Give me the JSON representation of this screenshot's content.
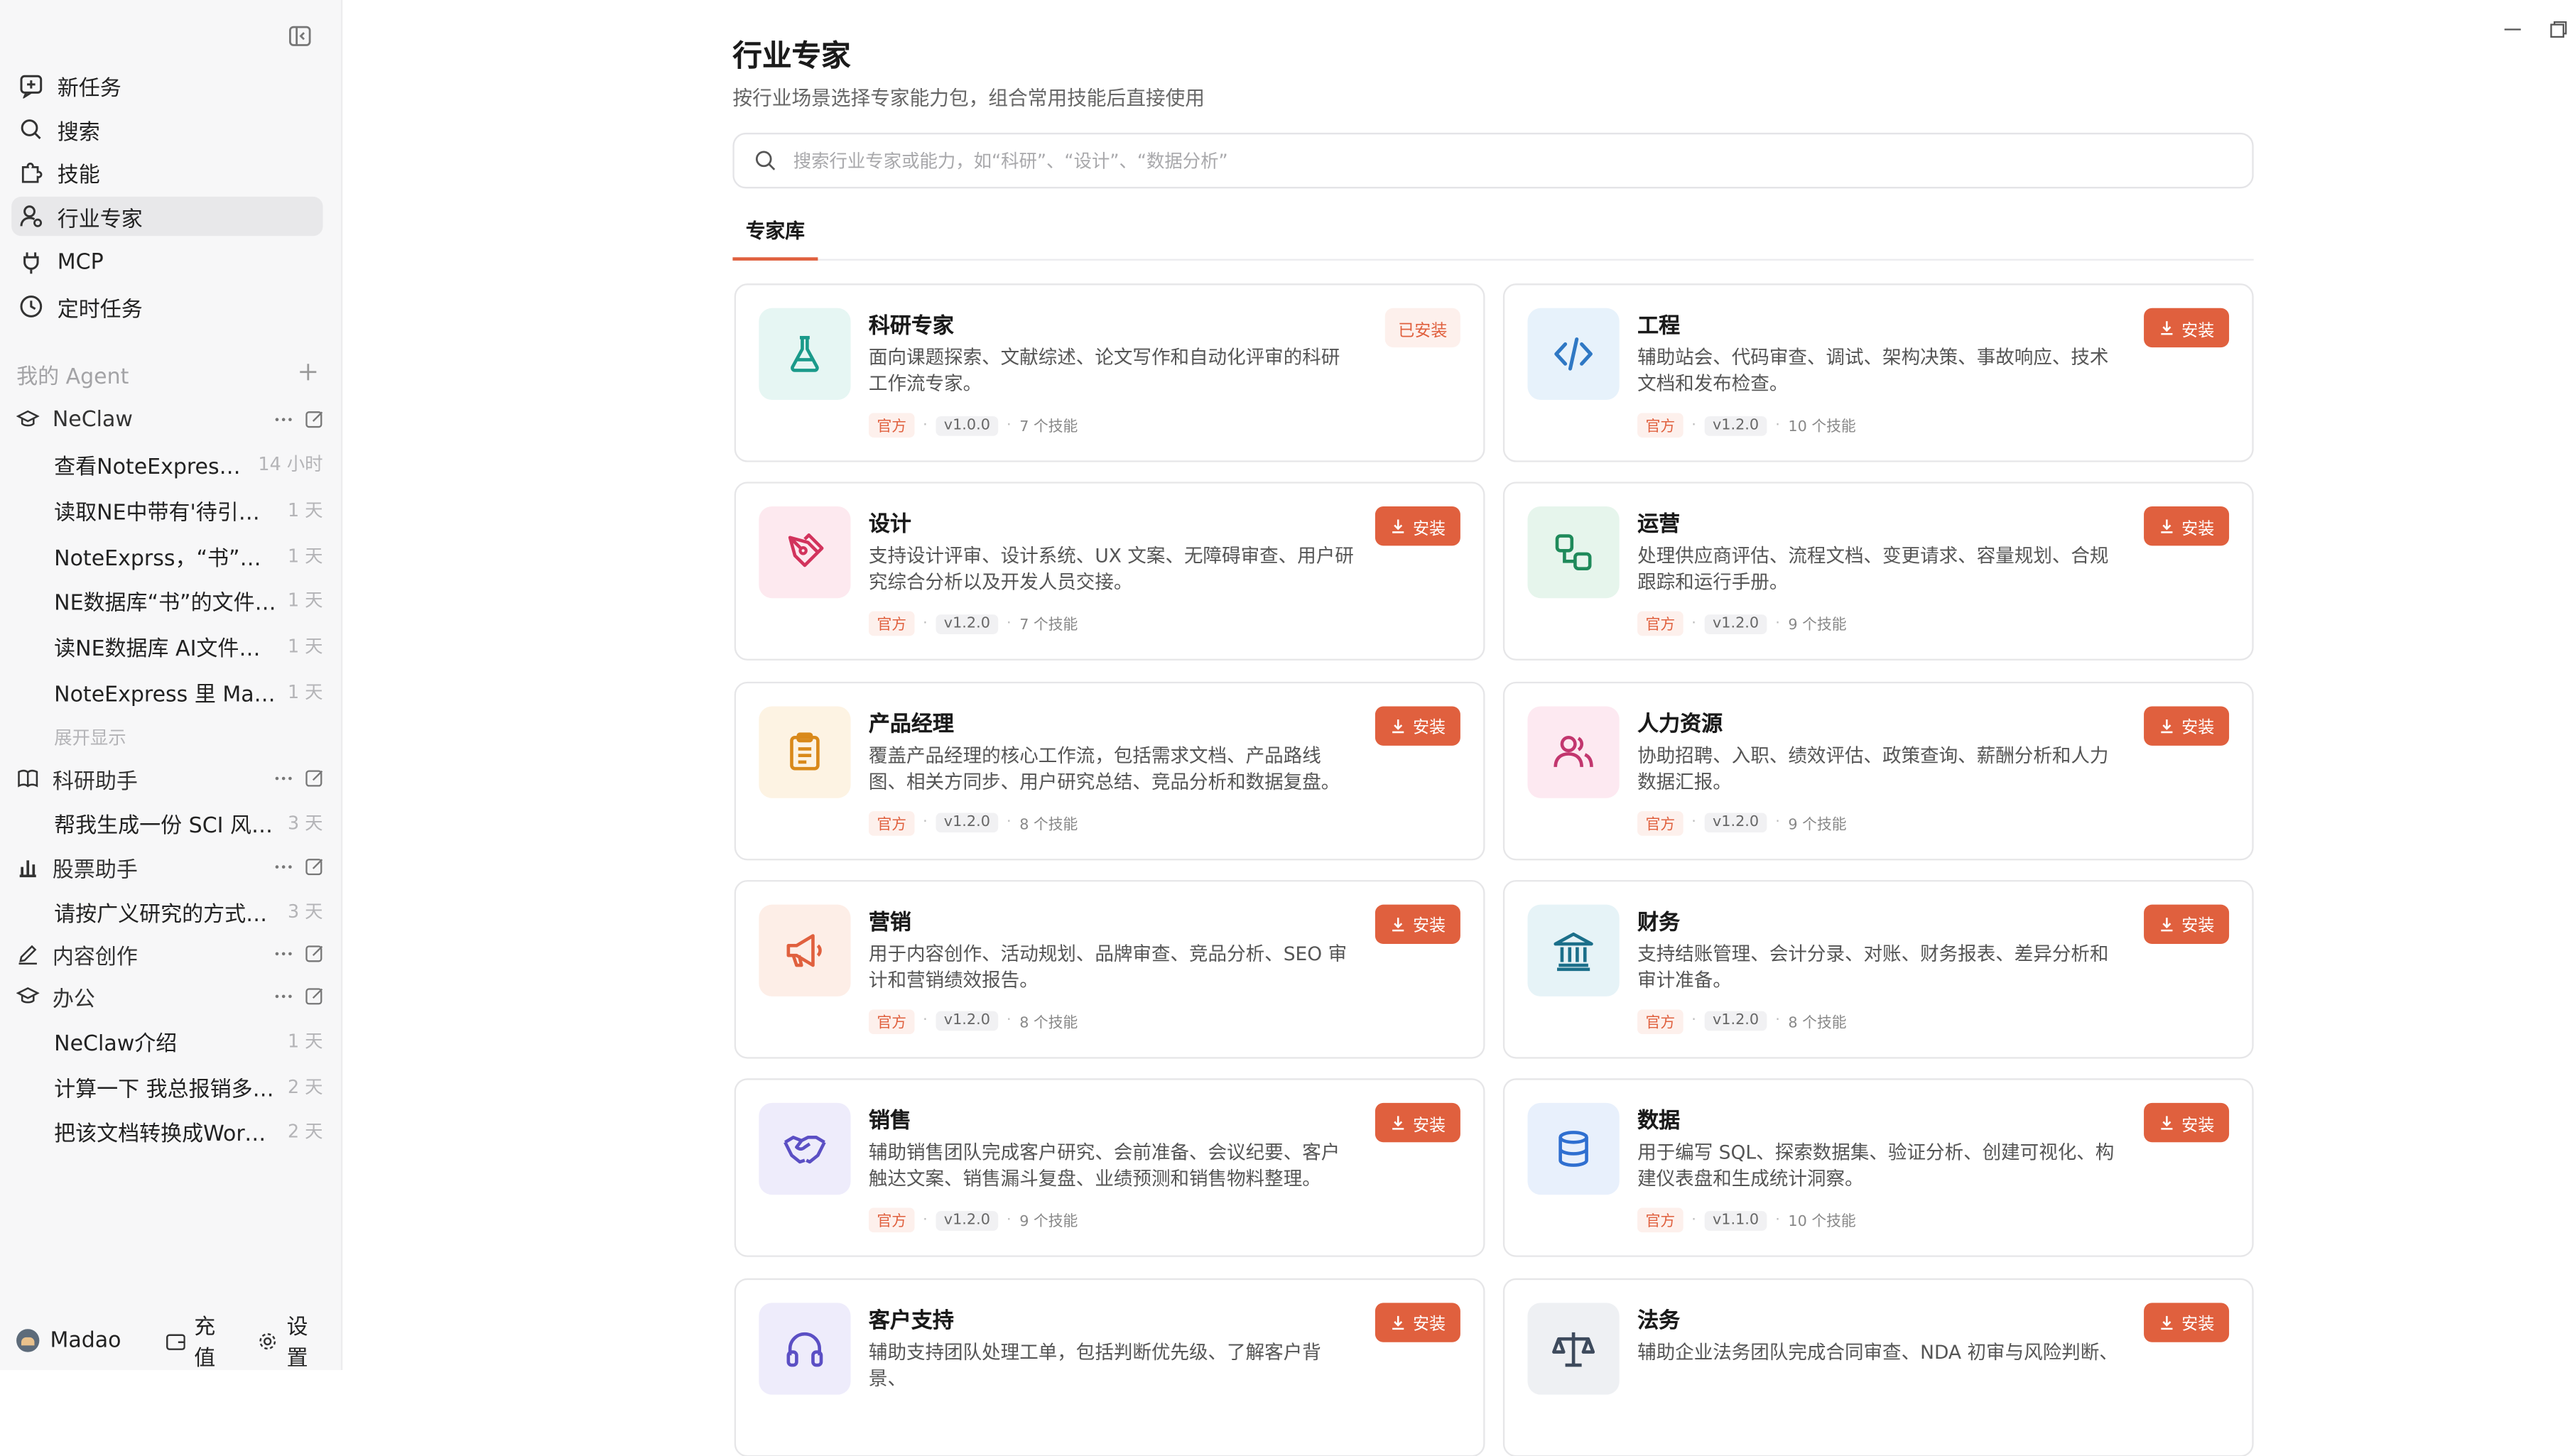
{
  "sidebar": {
    "nav": [
      {
        "label": "新任务",
        "icon": "new-task-icon"
      },
      {
        "label": "搜索",
        "icon": "search-icon"
      },
      {
        "label": "技能",
        "icon": "puzzle-icon"
      },
      {
        "label": "行业专家",
        "icon": "user-expert-icon",
        "active": true
      },
      {
        "label": "MCP",
        "icon": "plug-icon"
      },
      {
        "label": "定时任务",
        "icon": "clock-icon"
      }
    ],
    "section_title": "我的 Agent",
    "agents": [
      {
        "name": "NeClaw",
        "icon": "graduation-cap-icon"
      },
      {
        "name": "科研助手",
        "icon": "book-icon"
      },
      {
        "name": "股票助手",
        "icon": "bar-chart-icon"
      },
      {
        "name": "内容创作",
        "icon": "pen-icon"
      },
      {
        "name": "办公",
        "icon": "graduation-cap-icon"
      }
    ],
    "neclaw_convs": [
      {
        "title": "查看NoteExpress数...",
        "time": "14 小时"
      },
      {
        "title": "读取NE中带有'待引用'...",
        "time": "1 天"
      },
      {
        "title": "NoteExprss，“书”文件...",
        "time": "1 天"
      },
      {
        "title": "NE数据库“书”的文件夹...",
        "time": "1 天"
      },
      {
        "title": "读NE数据库 AI文件夹...",
        "time": "1 天"
      },
      {
        "title": "NoteExpress 里 Math...",
        "time": "1 天"
      }
    ],
    "expand_more": "展开显示",
    "research_convs": [
      {
        "title": "帮我生成一份 SCI 风格...",
        "time": "3 天"
      }
    ],
    "stock_convs": [
      {
        "title": "请按广义研究的方式，...",
        "time": "3 天"
      }
    ],
    "office_convs": [
      {
        "title": "NeClaw介绍",
        "time": "1 天"
      },
      {
        "title": "计算一下 我总报销多少...",
        "time": "2 天"
      },
      {
        "title": "把该文档转换成Word ...",
        "time": "2 天"
      }
    ],
    "footer": {
      "user": "Madao",
      "recharge": "充值",
      "settings": "设置"
    }
  },
  "main": {
    "title": "行业专家",
    "subtitle": "按行业场景选择专家能力包，组合常用技能后直接使用",
    "search_placeholder": "搜索行业专家或能力，如“科研”、“设计”、“数据分析”",
    "tab": "专家库",
    "official_label": "官方",
    "install_label": "安装",
    "installed_label": "已安装",
    "cards": [
      {
        "title": "科研专家",
        "desc": "面向课题探索、文献综述、论文写作和自动化评审的科研工作流专家。",
        "version": "v1.0.0",
        "skills": "7 个技能",
        "installed": true,
        "icon": "flask-icon",
        "color": "#1a9a8a",
        "bg": "#e6f6f3"
      },
      {
        "title": "工程",
        "desc": "辅助站会、代码审查、调试、架构决策、事故响应、技术文档和发布检查。",
        "version": "v1.2.0",
        "skills": "10 个技能",
        "installed": false,
        "icon": "code-icon",
        "color": "#2f78c4",
        "bg": "#e7f2fb"
      },
      {
        "title": "设计",
        "desc": "支持设计评审、设计系统、UX 文案、无障碍审查、用户研究综合分析以及开发人员交接。",
        "version": "v1.2.0",
        "skills": "7 个技能",
        "installed": false,
        "icon": "pen-nib-icon",
        "color": "#d2335c",
        "bg": "#fde9ef"
      },
      {
        "title": "运营",
        "desc": "处理供应商评估、流程文档、变更请求、容量规划、合规跟踪和运行手册。",
        "version": "v1.2.0",
        "skills": "9 个技能",
        "installed": false,
        "icon": "workflow-icon",
        "color": "#1f8a5a",
        "bg": "#e6f5ec"
      },
      {
        "title": "产品经理",
        "desc": "覆盖产品经理的核心工作流，包括需求文档、产品路线图、相关方同步、用户研究总结、竞品分析和数据复盘。",
        "version": "v1.2.0",
        "skills": "8 个技能",
        "installed": false,
        "icon": "clipboard-icon",
        "color": "#d9891a",
        "bg": "#fdf3e3"
      },
      {
        "title": "人力资源",
        "desc": "协助招聘、入职、绩效评估、政策查询、薪酬分析和人力数据汇报。",
        "version": "v1.2.0",
        "skills": "9 个技能",
        "installed": false,
        "icon": "users-icon",
        "color": "#c2366e",
        "bg": "#fde9f1"
      },
      {
        "title": "营销",
        "desc": "用于内容创作、活动规划、品牌审查、竞品分析、SEO 审计和营销绩效报告。",
        "version": "v1.2.0",
        "skills": "8 个技能",
        "installed": false,
        "icon": "megaphone-icon",
        "color": "#e0603e",
        "bg": "#fdeee7"
      },
      {
        "title": "财务",
        "desc": "支持结账管理、会计分录、对账、财务报表、差异分析和审计准备。",
        "version": "v1.2.0",
        "skills": "8 个技能",
        "installed": false,
        "icon": "bank-icon",
        "color": "#1b6f8a",
        "bg": "#e6f3f7"
      },
      {
        "title": "销售",
        "desc": "辅助销售团队完成客户研究、会前准备、会议纪要、客户触达文案、销售漏斗复盘、业绩预测和销售物料整理。",
        "version": "v1.2.0",
        "skills": "9 个技能",
        "installed": false,
        "icon": "handshake-icon",
        "color": "#5b4fc4",
        "bg": "#eeecfb"
      },
      {
        "title": "数据",
        "desc": "用于编写 SQL、探索数据集、验证分析、创建可视化、构建仪表盘和生成统计洞察。",
        "version": "v1.1.0",
        "skills": "10 个技能",
        "installed": false,
        "icon": "database-icon",
        "color": "#2f6fd0",
        "bg": "#e8f0fc"
      },
      {
        "title": "客户支持",
        "desc": "辅助支持团队处理工单，包括判断优先级、了解客户背景、",
        "version": "",
        "skills": "",
        "installed": false,
        "icon": "headset-icon",
        "color": "#5b4fc4",
        "bg": "#eeecfb"
      },
      {
        "title": "法务",
        "desc": "辅助企业法务团队完成合同审查、NDA 初审与风险判断、",
        "version": "",
        "skills": "",
        "installed": false,
        "icon": "scale-icon",
        "color": "#3d4a5c",
        "bg": "#eef0f3"
      }
    ]
  }
}
